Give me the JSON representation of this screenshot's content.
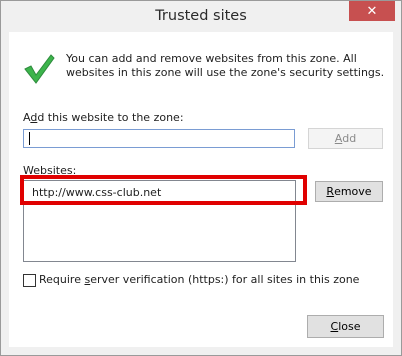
{
  "window": {
    "title": "Trusted sites",
    "close_glyph": "✕"
  },
  "info_text": "You can add and remove websites from this zone. All websites in this zone will use the zone's security settings.",
  "add_section": {
    "label_key": "d",
    "label_prefix": "A",
    "label_rest": "d this website to the zone:",
    "input_value": "",
    "add_button_key": "A",
    "add_button_rest": "dd"
  },
  "websites": {
    "label_key": "W",
    "label_rest": "ebsites:",
    "items": [
      "http://www.css-club.net"
    ],
    "remove_button_key": "R",
    "remove_button_rest": "emove"
  },
  "require_server": {
    "label_before": "Require ",
    "label_key": "s",
    "label_after": "erver verification (https:) for all sites in this zone",
    "checked": false
  },
  "close_button": {
    "key": "C",
    "rest": "lose"
  },
  "icons": {
    "check": "check-icon",
    "close": "close-icon"
  },
  "colors": {
    "close_button_bg": "#c75050",
    "highlight": "#e00000",
    "check_green": "#3cb44b"
  }
}
